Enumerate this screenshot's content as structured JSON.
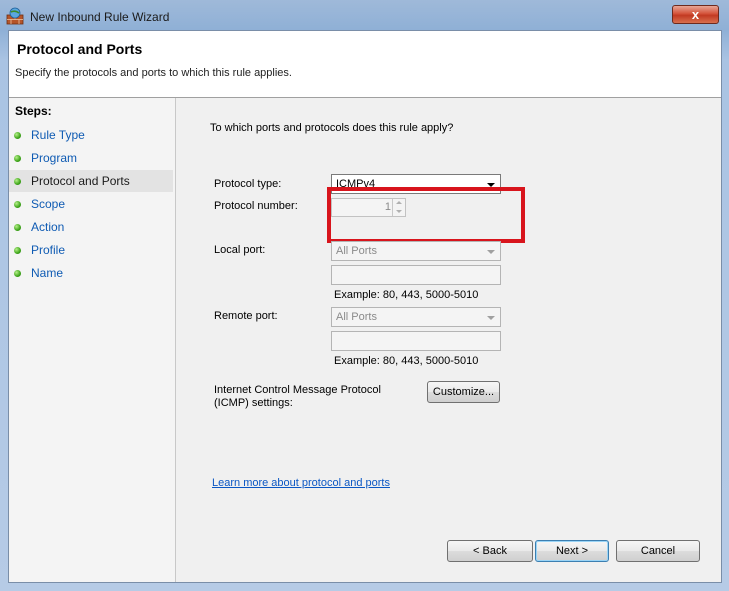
{
  "window": {
    "title": "New Inbound Rule Wizard",
    "close_label": "x"
  },
  "header": {
    "title": "Protocol and Ports",
    "subtitle": "Specify the protocols and ports to which this rule applies."
  },
  "steps": {
    "title": "Steps:",
    "items": [
      {
        "label": "Rule Type"
      },
      {
        "label": "Program"
      },
      {
        "label": "Protocol and Ports"
      },
      {
        "label": "Scope"
      },
      {
        "label": "Action"
      },
      {
        "label": "Profile"
      },
      {
        "label": "Name"
      }
    ]
  },
  "form": {
    "question": "To which ports and protocols does this rule apply?",
    "protocol_type_label": "Protocol type:",
    "protocol_type_value": "ICMPv4",
    "protocol_number_label": "Protocol number:",
    "protocol_number_value": "1",
    "local_port_label": "Local port:",
    "local_port_value": "All Ports",
    "local_port_example": "Example: 80, 443, 5000-5010",
    "remote_port_label": "Remote port:",
    "remote_port_value": "All Ports",
    "remote_port_example": "Example: 80, 443, 5000-5010",
    "icmp_label_line1": "Internet Control Message Protocol",
    "icmp_label_line2": "(ICMP) settings:",
    "customize_label": "Customize...",
    "learn_more": "Learn more about protocol and ports"
  },
  "buttons": {
    "back": "< Back",
    "next": "Next >",
    "cancel": "Cancel"
  },
  "colors": {
    "highlight": "#d8141c",
    "link": "#0b57c4",
    "step_link": "#0f5bb3"
  }
}
